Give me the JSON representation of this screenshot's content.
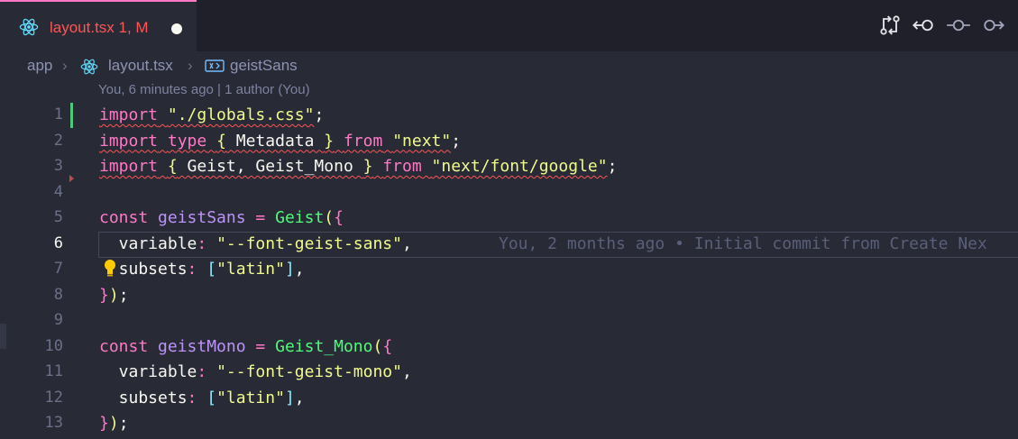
{
  "tab": {
    "filename": "layout.tsx",
    "status": "1, M",
    "title": "layout.tsx 1, M",
    "icon": "react-icon",
    "modified": true
  },
  "tab_actions": [
    "git-compare-icon",
    "go-back-icon",
    "git-commit-icon",
    "go-forward-icon"
  ],
  "breadcrumb": {
    "folder": "app",
    "file": "layout.tsx",
    "symbol": "geistSans"
  },
  "codelens": "You, 6 minutes ago | 1 author (You)",
  "blame": "You, 2 months ago • Initial commit from Create Nex",
  "colors": {
    "keyword": "#ff79c6",
    "string": "#f1fa8c",
    "function": "#50fa7b",
    "variable": "#bd93f9",
    "error": "#ff5555",
    "background": "#282a36"
  },
  "lines": [
    {
      "n": "1",
      "parts": [
        [
          "k w",
          "import"
        ],
        [
          "p w",
          " "
        ],
        [
          "s w",
          "\"./globals.css\""
        ],
        [
          "p",
          ";"
        ]
      ]
    },
    {
      "n": "2",
      "parts": [
        [
          "k w",
          "import"
        ],
        [
          "p w",
          " "
        ],
        [
          "k w",
          "type"
        ],
        [
          "p w",
          " "
        ],
        [
          "br1 w",
          "{"
        ],
        [
          "p w",
          " Metadata "
        ],
        [
          "br1 w",
          "}"
        ],
        [
          "p w",
          " "
        ],
        [
          "k w",
          "from"
        ],
        [
          "p w",
          " "
        ],
        [
          "s w",
          "\"next\""
        ],
        [
          "p",
          ";"
        ]
      ]
    },
    {
      "n": "3",
      "parts": [
        [
          "k w",
          "import"
        ],
        [
          "p w",
          " "
        ],
        [
          "br1 w",
          "{"
        ],
        [
          "p w",
          " Geist, Geist_Mono "
        ],
        [
          "br1 w",
          "}"
        ],
        [
          "p w",
          " "
        ],
        [
          "k w",
          "from"
        ],
        [
          "p w",
          " "
        ],
        [
          "s w",
          "\"next/font/google\""
        ],
        [
          "p",
          ";"
        ]
      ]
    },
    {
      "n": "4",
      "parts": []
    },
    {
      "n": "5",
      "parts": [
        [
          "k",
          "const"
        ],
        [
          "p",
          " "
        ],
        [
          "v",
          "geistSans"
        ],
        [
          "p",
          " "
        ],
        [
          "k",
          "="
        ],
        [
          "p",
          " "
        ],
        [
          "f",
          "Geist"
        ],
        [
          "br1",
          "("
        ],
        [
          "br2",
          "{"
        ]
      ]
    },
    {
      "n": "6",
      "parts": [
        [
          "p",
          "  variable"
        ],
        [
          "k",
          ":"
        ],
        [
          "p",
          " "
        ],
        [
          "s",
          "\"--font-geist-sans\""
        ],
        [
          "p",
          ","
        ]
      ]
    },
    {
      "n": "7",
      "parts": [
        [
          "p",
          "  subsets"
        ],
        [
          "k",
          ":"
        ],
        [
          "p",
          " "
        ],
        [
          "br3",
          "["
        ],
        [
          "s",
          "\"latin\""
        ],
        [
          "br3",
          "]"
        ],
        [
          "p",
          ","
        ]
      ]
    },
    {
      "n": "8",
      "parts": [
        [
          "br2",
          "}"
        ],
        [
          "br1",
          ")"
        ],
        [
          "p",
          ";"
        ]
      ]
    },
    {
      "n": "9",
      "parts": []
    },
    {
      "n": "10",
      "parts": [
        [
          "k",
          "const"
        ],
        [
          "p",
          " "
        ],
        [
          "v",
          "geistMono"
        ],
        [
          "p",
          " "
        ],
        [
          "k",
          "="
        ],
        [
          "p",
          " "
        ],
        [
          "f",
          "Geist_Mono"
        ],
        [
          "br1",
          "("
        ],
        [
          "br2",
          "{"
        ]
      ]
    },
    {
      "n": "11",
      "parts": [
        [
          "p",
          "  variable"
        ],
        [
          "k",
          ":"
        ],
        [
          "p",
          " "
        ],
        [
          "s",
          "\"--font-geist-mono\""
        ],
        [
          "p",
          ","
        ]
      ]
    },
    {
      "n": "12",
      "parts": [
        [
          "p",
          "  subsets"
        ],
        [
          "k",
          ":"
        ],
        [
          "p",
          " "
        ],
        [
          "br3",
          "["
        ],
        [
          "s",
          "\"latin\""
        ],
        [
          "br3",
          "]"
        ],
        [
          "p",
          ","
        ]
      ]
    },
    {
      "n": "13",
      "parts": [
        [
          "br2",
          "}"
        ],
        [
          "br1",
          ")"
        ],
        [
          "p",
          ";"
        ]
      ]
    }
  ],
  "active_line": "6"
}
